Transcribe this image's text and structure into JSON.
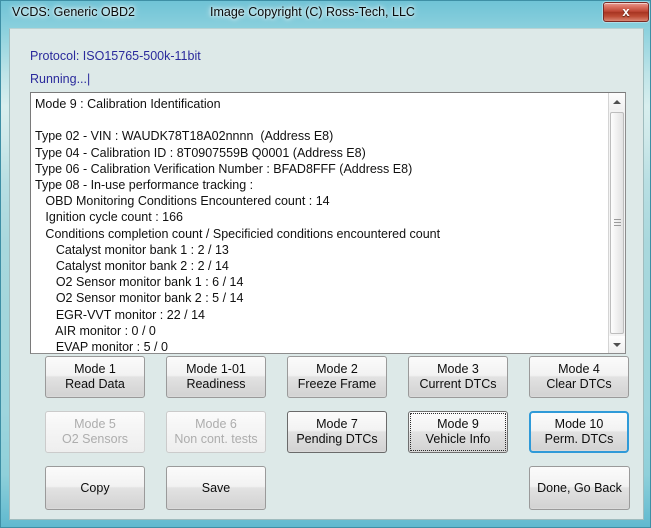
{
  "window": {
    "app_title": "VCDS:  Generic OBD2",
    "copyright": "Image Copyright (C) Ross-Tech, LLC",
    "close_glyph": "x",
    "close_icon": "close-icon",
    "accent_color": "#2f9ad8",
    "titlebar_color": "#8fd2de",
    "client_color": "#dde9e8",
    "label_color": "#2a2a9c"
  },
  "header": {
    "protocol": "Protocol: ISO15765-500k-11bit",
    "status": "Running...|"
  },
  "output": {
    "text": "Mode 9 : Calibration Identification\n\nType 02 - VIN : WAUDK78T18A02nnnn  (Address E8)\nType 04 - Calibration ID : 8T0907559B Q0001 (Address E8)\nType 06 - Calibration Verification Number : BFAD8FFF (Address E8)\nType 08 - In-use performance tracking :\n   OBD Monitoring Conditions Encountered count : 14\n   Ignition cycle count : 166\n   Conditions completion count / Specificied conditions encountered count\n      Catalyst monitor bank 1 : 2 / 13\n      Catalyst monitor bank 2 : 2 / 14\n      O2 Sensor monitor bank 1 : 6 / 14\n      O2 Sensor monitor bank 2 : 5 / 14\n      EGR-VVT monitor : 22 / 14\n      AIR monitor : 0 / 0\n      EVAP monitor : 5 / 0",
    "lines": [
      "Mode 9 : Calibration Identification",
      "",
      "Type 02 - VIN : WAUDK78T18A02nnnn  (Address E8)",
      "Type 04 - Calibration ID : 8T0907559B Q0001 (Address E8)",
      "Type 06 - Calibration Verification Number : BFAD8FFF (Address E8)",
      "Type 08 - In-use performance tracking :",
      "   OBD Monitoring Conditions Encountered count : 14",
      "   Ignition cycle count : 166",
      "   Conditions completion count / Specificied conditions encountered count",
      "      Catalyst monitor bank 1 : 2 / 13",
      "      Catalyst monitor bank 2 : 2 / 14",
      "      O2 Sensor monitor bank 1 : 6 / 14",
      "      O2 Sensor monitor bank 2 : 5 / 14",
      "      EGR-VVT monitor : 22 / 14",
      "      AIR monitor : 0 / 0",
      "      EVAP monitor : 5 / 0"
    ],
    "scrollbar": {
      "up_icon": "scroll-up-arrow-icon",
      "down_icon": "scroll-down-arrow-icon",
      "grip_icon": "scroll-thumb-grip-icon"
    }
  },
  "buttons": {
    "mode1": {
      "line1": "Mode 1",
      "line2": "Read Data"
    },
    "mode1_01": {
      "line1": "Mode 1-01",
      "line2": "Readiness"
    },
    "mode2": {
      "line1": "Mode 2",
      "line2": "Freeze Frame"
    },
    "mode3": {
      "line1": "Mode 3",
      "line2": "Current DTCs"
    },
    "mode4": {
      "line1": "Mode 4",
      "line2": "Clear DTCs"
    },
    "mode5": {
      "line1": "Mode 5",
      "line2": "O2 Sensors"
    },
    "mode6": {
      "line1": "Mode 6",
      "line2": "Non cont. tests"
    },
    "mode7": {
      "line1": "Mode 7",
      "line2": "Pending DTCs"
    },
    "mode9": {
      "line1": "Mode 9",
      "line2": "Vehicle Info"
    },
    "mode10": {
      "line1": "Mode 10",
      "line2": "Perm. DTCs"
    },
    "copy": "Copy",
    "save": "Save",
    "done": "Done, Go Back"
  }
}
